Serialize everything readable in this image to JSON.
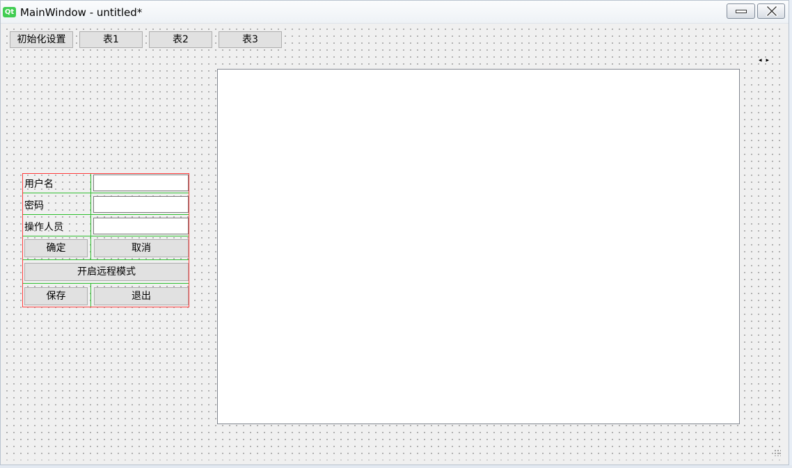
{
  "window": {
    "icon_text": "Qt",
    "title": "MainWindow - untitled*"
  },
  "toolbar": {
    "buttons": [
      "初始化设置",
      "表1",
      "表2",
      "表3"
    ]
  },
  "nav": {
    "arrows": "◂▸"
  },
  "login_form": {
    "username_label": "用户名",
    "username_value": "",
    "password_label": "密码",
    "password_value": "",
    "operator_label": "操作人员",
    "operator_value": "",
    "confirm_label": "确定",
    "cancel_label": "取消",
    "remote_mode_label": "开启远程模式",
    "save_label": "保存",
    "exit_label": "退出"
  },
  "colors": {
    "layout_border": "#ff3b3b",
    "grid_lines": "#2fbf2f",
    "qt_brand": "#41cd52"
  }
}
